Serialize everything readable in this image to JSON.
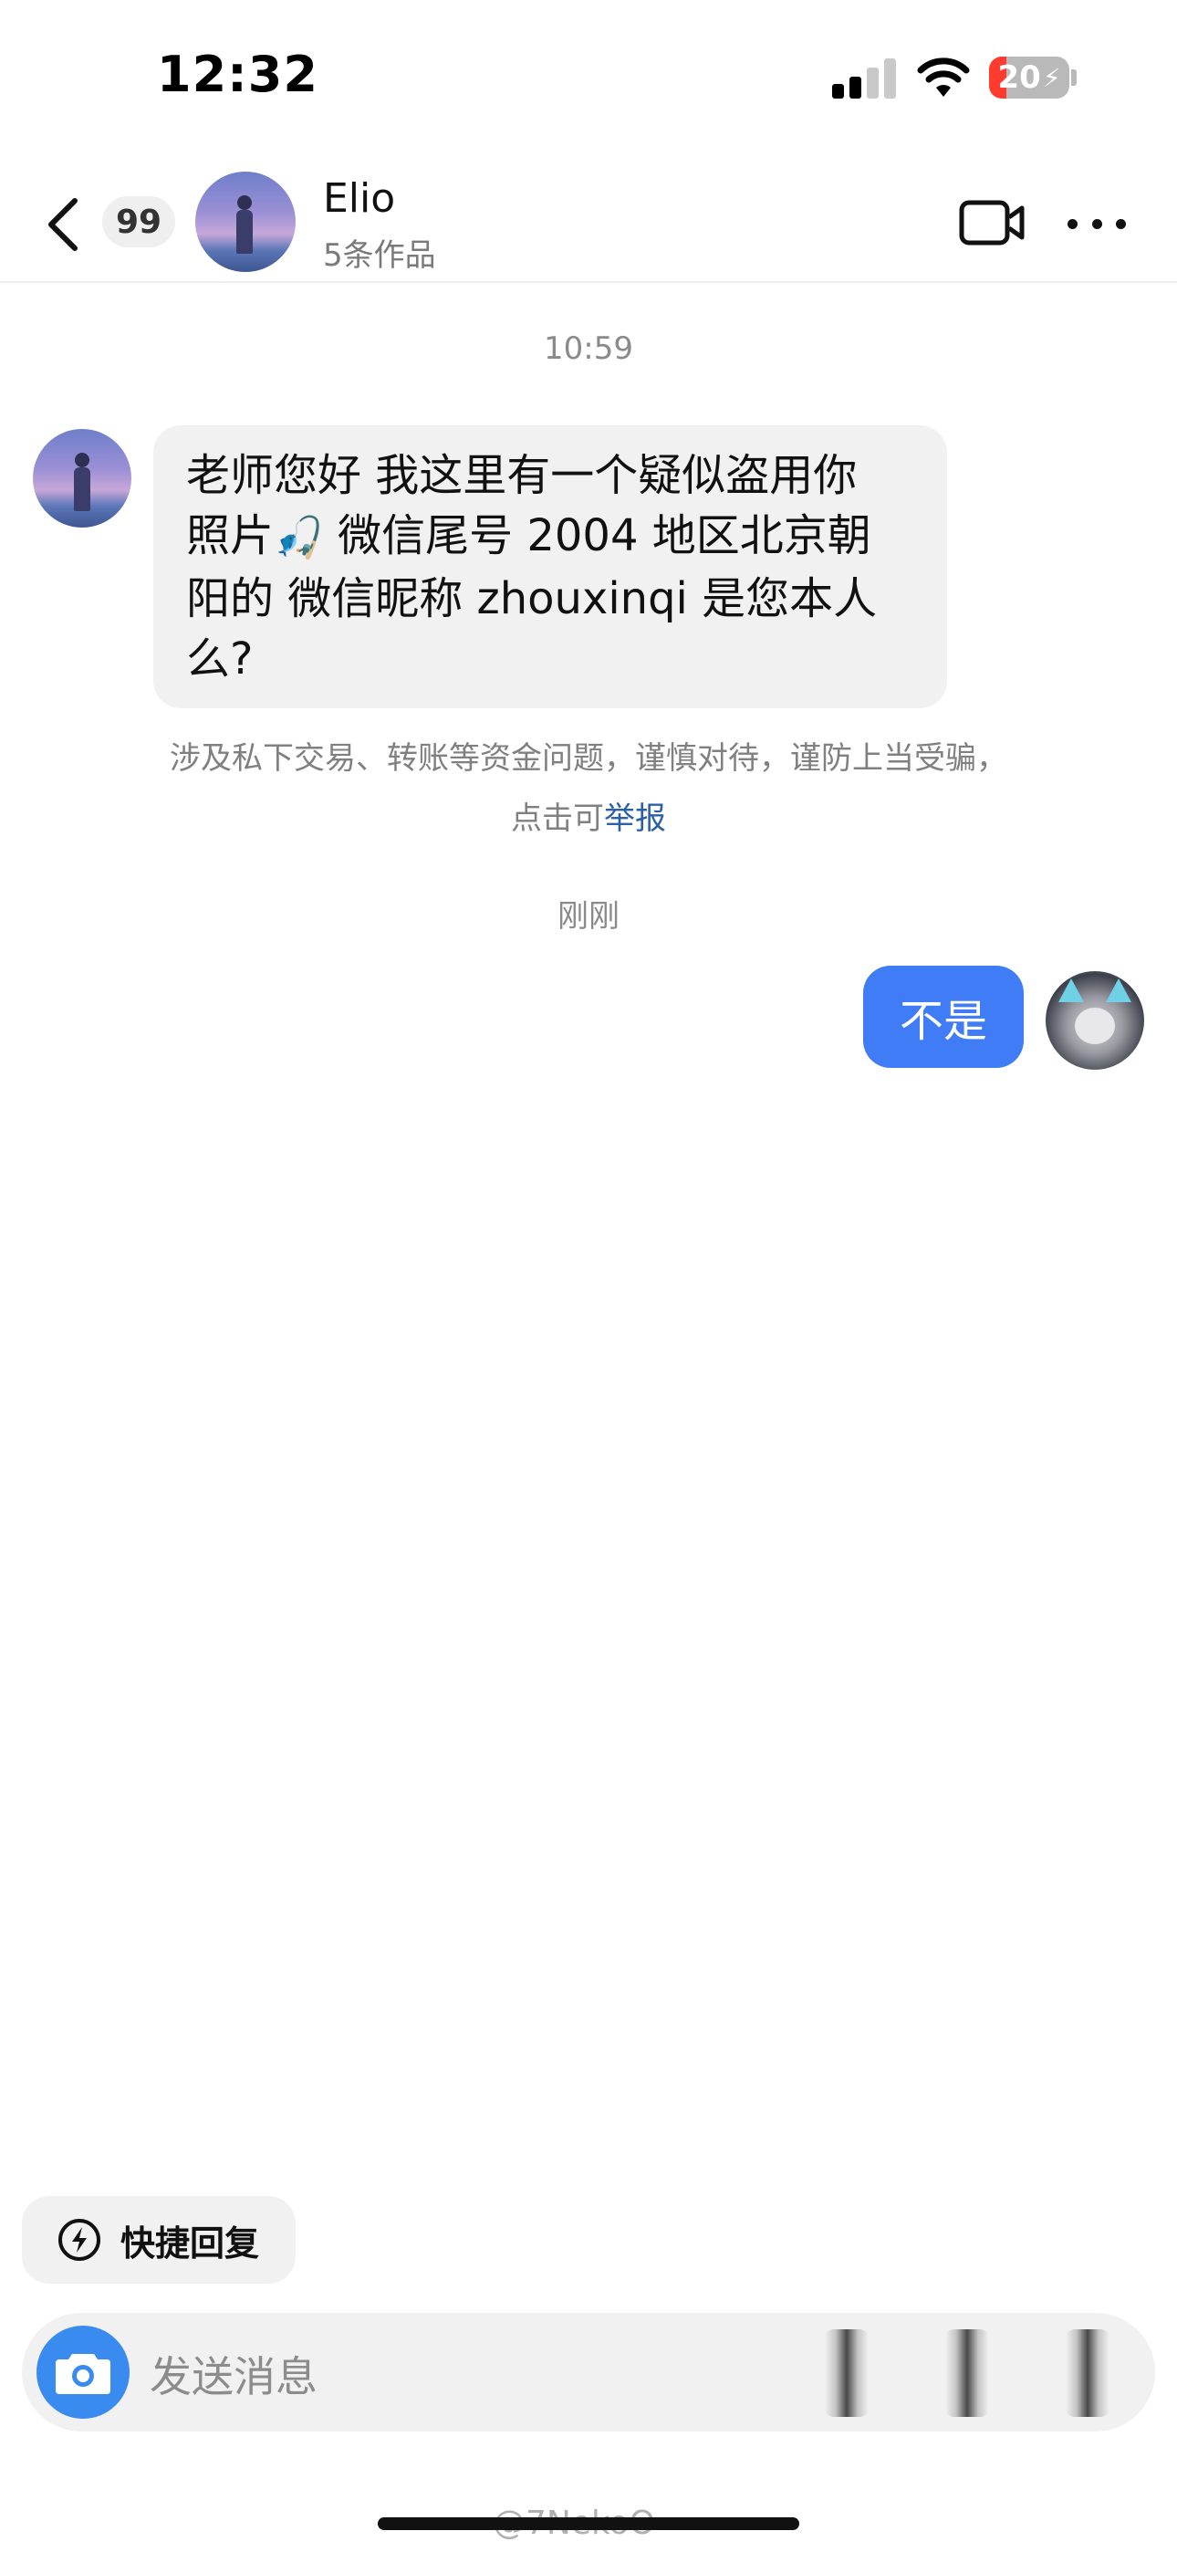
{
  "status_bar": {
    "time": "12:32",
    "battery_level": "20",
    "battery_color": "#ff3b30",
    "icons": [
      "cellular-signal-icon",
      "wifi-icon",
      "battery-charging-icon"
    ]
  },
  "header": {
    "badge_count": "99",
    "name": "Elio",
    "subtitle": "5条作品",
    "icons": [
      "back-chevron-icon",
      "video-call-icon",
      "more-icon"
    ]
  },
  "chat": {
    "timestamp_1": "10:59",
    "incoming_message": {
      "line_1": "老师您好 我这里有一个疑似盗用你",
      "line_2_a": "照片",
      "line_2_emoji": "🎣",
      "line_2_b": " 微信尾号 2004 地区北京朝",
      "line_3": "阳的 微信昵称 zhouxinqi 是您本人",
      "line_4": "么?"
    },
    "safety_notice": {
      "line_1": "涉及私下交易、转账等资金问题，谨慎对待，谨防上当受骗，",
      "line_2_prefix": "点击可",
      "report_link": "举报"
    },
    "timestamp_2": "刚刚",
    "outgoing_message": "不是"
  },
  "quick_reply": {
    "label": "快捷回复"
  },
  "input": {
    "placeholder": "发送消息"
  },
  "colors": {
    "accent": "#3f7cf6",
    "link": "#2b5fa8",
    "camera_button": "#3a8bf0"
  },
  "watermark": "@7NekoO"
}
